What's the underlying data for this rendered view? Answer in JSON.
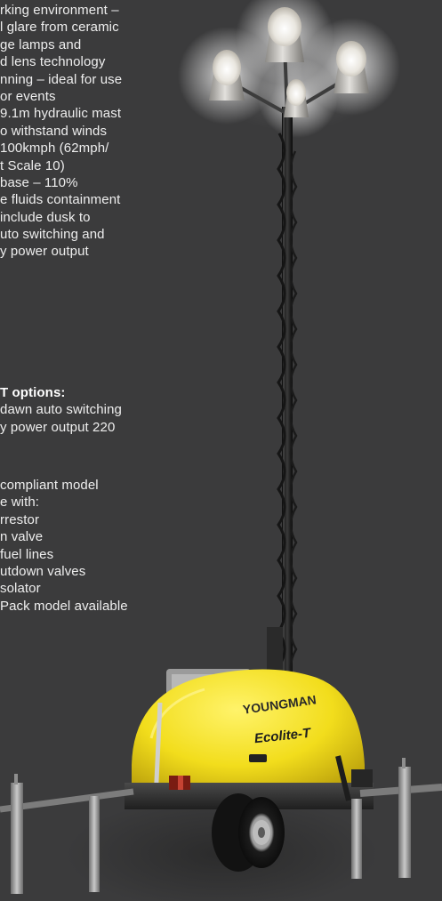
{
  "features": {
    "lines": [
      "rking environment –",
      "l glare from ceramic",
      "ge lamps and",
      "d lens technology",
      "nning – ideal for use",
      "or events",
      "9.1m hydraulic mast",
      "o withstand winds",
      " 100kmph (62mph/",
      "t Scale 10)",
      " base – 110%",
      "e fluids containment",
      " include dusk to",
      "uto switching and",
      "y power output"
    ]
  },
  "options": {
    "heading": "T options:",
    "lines": [
      "dawn auto switching",
      "y power output 220"
    ]
  },
  "compliant": {
    "lines": [
      "compliant model",
      "e with:",
      "rrestor",
      "n valve",
      " fuel lines",
      "utdown valves",
      "solator",
      "Pack model available"
    ]
  },
  "product": {
    "brand": "YOUNGMAN",
    "model": "Ecolite-T",
    "body_color": "#f2dd1c"
  }
}
